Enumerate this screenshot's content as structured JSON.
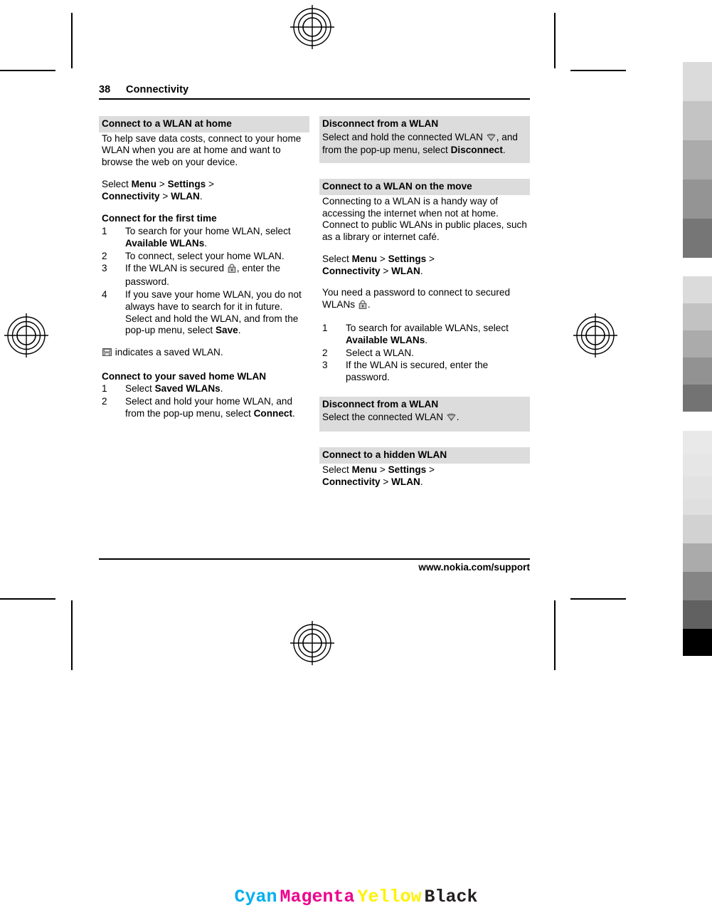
{
  "page": {
    "number": "38",
    "chapter": "Connectivity",
    "footer_url": "www.nokia.com/support"
  },
  "left_column": {
    "section1": {
      "heading": "Connect to a WLAN at home",
      "intro": "To help save data costs, connect to your home WLAN when you are at home and want to browse the web on your device.",
      "path_prefix": "Select ",
      "path_menu": "Menu",
      "path_sep1": " > ",
      "path_settings": "Settings",
      "path_sep2": " > ",
      "path_connectivity": "Connectivity",
      "path_sep3": " > ",
      "path_wlan": "WLAN",
      "path_period": "."
    },
    "first_time": {
      "heading": "Connect for the first time",
      "steps": [
        {
          "num": "1",
          "before": "To search for your home WLAN, select ",
          "bold": "Available WLANs",
          "after": "."
        },
        {
          "num": "2",
          "before": "To connect, select your home WLAN.",
          "bold": "",
          "after": ""
        },
        {
          "num": "3",
          "before": "If the WLAN is secured ",
          "icon": "lock-icon",
          "after": ", enter the password."
        },
        {
          "num": "4",
          "before": "If you save your home WLAN, you do not always have to search for it in future. Select and hold the WLAN, and from the pop-up menu, select ",
          "bold": "Save",
          "after": "."
        }
      ]
    },
    "saved_note": {
      "icon": "saved-wlan-icon",
      "text": " indicates a saved WLAN."
    },
    "saved_home": {
      "heading": "Connect to your saved home WLAN",
      "steps": [
        {
          "num": "1",
          "before": "Select ",
          "bold": "Saved WLANs",
          "after": "."
        },
        {
          "num": "2",
          "before": "Select and hold your home WLAN, and from the pop-up menu, select ",
          "bold": "Connect",
          "after": "."
        }
      ]
    }
  },
  "right_column": {
    "disconnect1": {
      "heading": "Disconnect from a WLAN",
      "before": "Select and hold the connected WLAN ",
      "icon": "wlan-signal-icon",
      "middle": ", and from the pop-up menu, select ",
      "bold": "Disconnect",
      "after": "."
    },
    "on_the_move": {
      "heading": "Connect to a WLAN on the move",
      "intro": "Connecting to a WLAN is a handy way of accessing the internet when not at home. Connect to public WLANs in public places, such as a library or internet café.",
      "path_prefix": "Select ",
      "path_menu": "Menu",
      "path_sep1": " > ",
      "path_settings": "Settings",
      "path_sep2": " > ",
      "path_connectivity": "Connectivity",
      "path_sep3": " > ",
      "path_wlan": "WLAN",
      "path_period": ".",
      "password_note_before": "You need a password to connect to secured WLANs ",
      "password_note_icon": "lock-icon",
      "password_note_after": ".",
      "steps": [
        {
          "num": "1",
          "before": "To search for available WLANs, select ",
          "bold": "Available WLANs",
          "after": "."
        },
        {
          "num": "2",
          "before": "Select a WLAN.",
          "bold": "",
          "after": ""
        },
        {
          "num": "3",
          "before": "If the WLAN is secured, enter the password.",
          "bold": "",
          "after": ""
        }
      ]
    },
    "disconnect2": {
      "heading": "Disconnect from a WLAN",
      "before": "Select the connected WLAN ",
      "icon": "wlan-signal-icon",
      "after": "."
    },
    "hidden": {
      "heading": "Connect to a hidden WLAN",
      "path_prefix": "Select ",
      "path_menu": "Menu",
      "path_sep1": " > ",
      "path_settings": "Settings",
      "path_sep2": " > ",
      "path_connectivity": "Connectivity",
      "path_sep3": " > ",
      "path_wlan": "WLAN",
      "path_period": "."
    }
  },
  "print_marks": {
    "cmyk_labels": [
      {
        "name": "Cyan",
        "color": "#00AEEF"
      },
      {
        "name": "Magenta",
        "color": "#EC008C"
      },
      {
        "name": "Yellow",
        "color": "#FFF200"
      },
      {
        "name": "Black",
        "color": "#231F20"
      }
    ],
    "calibration_strip": {
      "group1": [
        "#dbdbdb",
        "#c4c4c4",
        "#ababab",
        "#949494",
        "#767676"
      ],
      "group2": [
        "#dbdbdb",
        "#c2c2c2",
        "#ababab",
        "#929292",
        "#737373"
      ],
      "group3": [
        "#e9e9e9",
        "#e6e6e6",
        "#e2e2e2",
        "#dfdfdf"
      ],
      "group4": [
        "#d2d2d2",
        "#ababab",
        "#858585",
        "#616161",
        "#000000"
      ]
    },
    "registration_mark": "registration-target"
  }
}
